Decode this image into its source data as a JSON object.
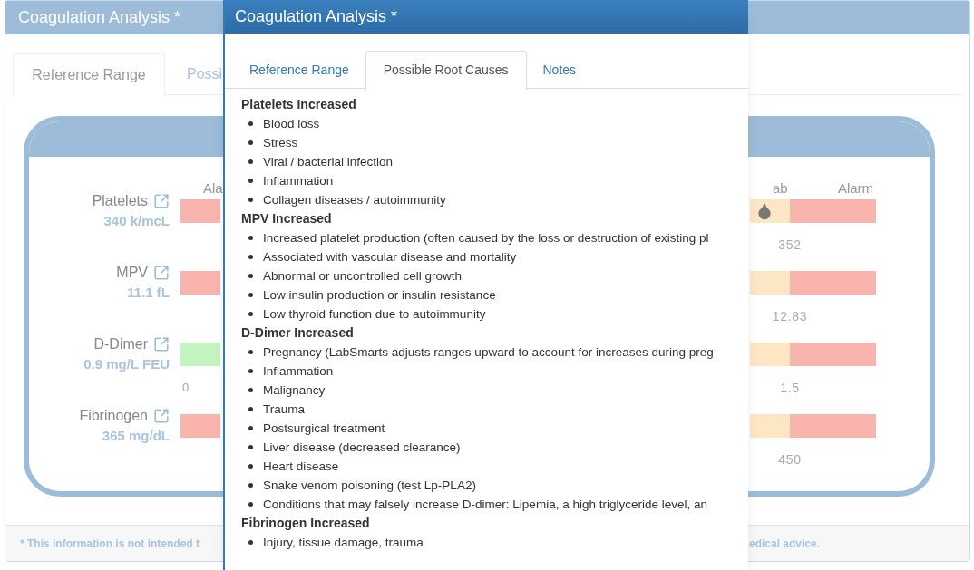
{
  "background_window": {
    "title": "Coagulation Analysis *",
    "tabs": [
      {
        "label": "Reference Range",
        "selected": true
      },
      {
        "label": "Possi",
        "selected": false
      }
    ],
    "panel": {
      "column_headers": [
        "Ala",
        "ab",
        "Alarm"
      ],
      "rows": [
        {
          "name": "Platelets",
          "value": "340 k/mcL",
          "color": "#f8b4ad",
          "marker": true,
          "reading": "352"
        },
        {
          "name": "MPV",
          "value": "11.1 fL",
          "color": "#f8b4ad",
          "marker": false,
          "reading": "12.83"
        },
        {
          "name": "D-Dimer",
          "value": "0.9 mg/L FEU",
          "color": "#c4f5c0",
          "marker": false,
          "scale_start": "0",
          "reading": "1.5"
        },
        {
          "name": "Fibrinogen",
          "value": "365 mg/dL",
          "color": "#f8b4ad",
          "marker": false,
          "reading": "450"
        }
      ]
    },
    "footer": [
      "* This information is not intended t",
      "edical advice."
    ]
  },
  "dialog": {
    "title": "Coagulation Analysis *",
    "tabs": [
      {
        "label": "Reference Range",
        "selected": false
      },
      {
        "label": "Possible Root Causes",
        "selected": true
      },
      {
        "label": "Notes",
        "selected": false
      }
    ],
    "sections": [
      {
        "heading": "Platelets Increased",
        "items": [
          "Blood loss",
          "Stress",
          "Viral / bacterial infection",
          "Inflammation",
          "Collagen diseases / autoimmunity"
        ]
      },
      {
        "heading": "MPV Increased",
        "items": [
          "Increased platelet production (often caused by the loss or destruction of existing pl",
          "Associated with vascular disease and mortality",
          "Abnormal or uncontrolled cell growth",
          "Low insulin production or insulin resistance",
          "Low thyroid function due to autoimmunity"
        ]
      },
      {
        "heading": "D-Dimer Increased",
        "items": [
          "Pregnancy (LabSmarts adjusts ranges upward to account for increases during preg",
          "Inflammation",
          "Malignancy",
          "Trauma",
          "Postsurgical treatment",
          "Liver disease (decreased clearance)",
          "Heart disease",
          "Snake venom poisoning (test Lp-PLA2)",
          "Conditions that may falsely increase D-dimer: Lipemia, a high triglyceride level, an"
        ]
      },
      {
        "heading": "Fibrinogen Increased",
        "items": [
          "Injury, tissue damage, trauma"
        ]
      }
    ]
  }
}
